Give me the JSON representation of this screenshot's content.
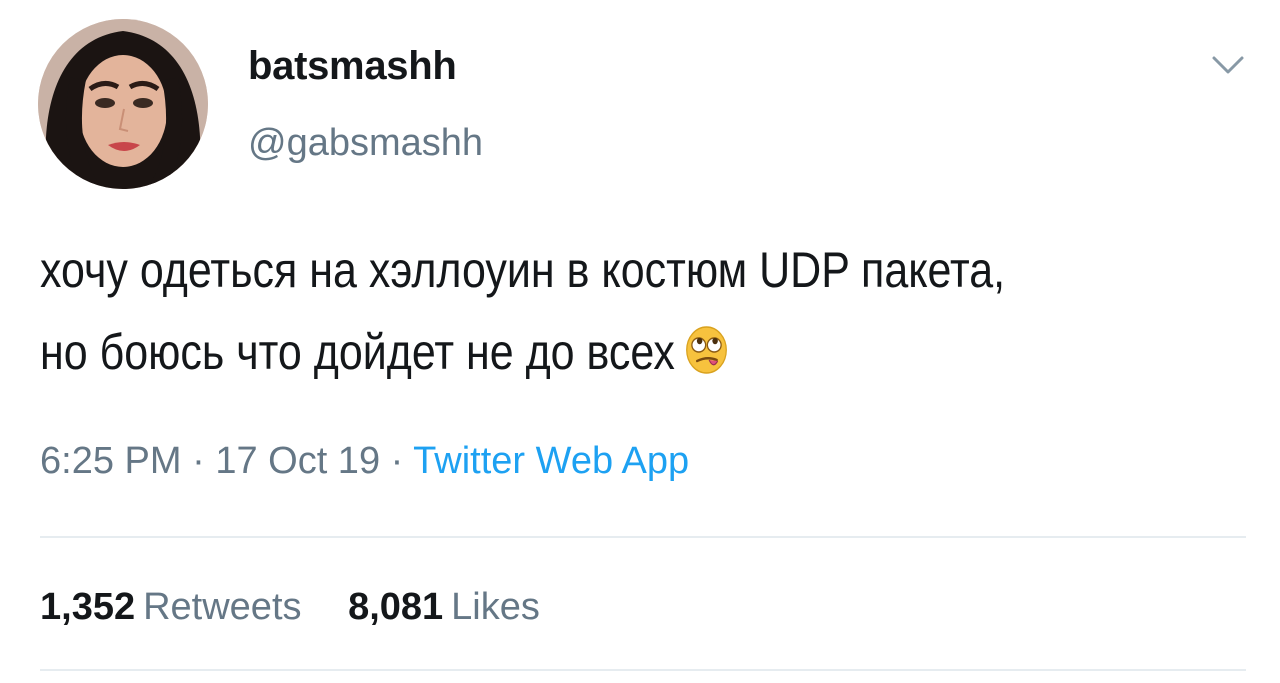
{
  "author": {
    "display_name": "batsmashh",
    "handle": "@gabsmashh"
  },
  "tweet": {
    "text_line_1": "хочу одеться на хэллоуин в костюм UDP пакета,",
    "text_line_2": "но боюсь что дойдет не до всех",
    "emoji": "face-with-rolling-eyes-and-tongue"
  },
  "meta": {
    "time": "6:25 PM",
    "separator": " · ",
    "date": "17 Oct 19",
    "source": "Twitter Web App"
  },
  "stats": {
    "retweets_count": "1,352",
    "retweets_label": "Retweets",
    "likes_count": "8,081",
    "likes_label": "Likes"
  },
  "colors": {
    "primary_text": "#14171a",
    "secondary_text": "#657786",
    "link": "#1da1f2",
    "divider": "#e6ecf0"
  }
}
